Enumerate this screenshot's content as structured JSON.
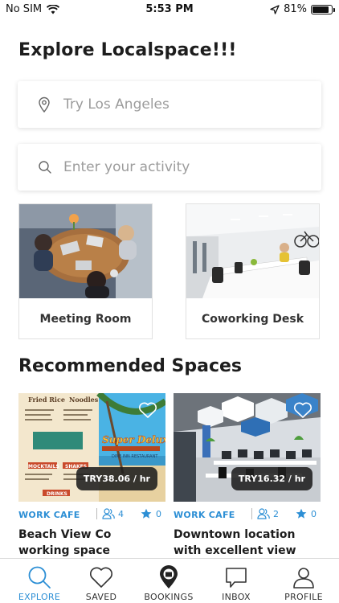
{
  "status_bar": {
    "carrier": "No SIM",
    "time": "5:53 PM",
    "battery": "81%",
    "battery_level": 0.81
  },
  "page_title": "Explore Localspace!!!",
  "search": {
    "location_placeholder": "Try Los Angeles",
    "activity_placeholder": "Enter your activity"
  },
  "categories": [
    {
      "label": "Meeting Room"
    },
    {
      "label": "Coworking Desk"
    }
  ],
  "section_title": "Recommended Spaces",
  "spaces": [
    {
      "type": "WORK CAFE",
      "capacity": "4",
      "rating": "0",
      "price": "TRY38.06 / hr",
      "title": "Beach View Co working space",
      "menu": {
        "left_head": "Fried Rice",
        "right_head": "Noodles",
        "sub1": "MOCKTAILS",
        "sub2": "SHAKES",
        "sub3": "DRINKS",
        "brand": "Super Deluxe",
        "tag": "DINE INN RESTAURANT"
      }
    },
    {
      "type": "WORK CAFE",
      "capacity": "2",
      "rating": "0",
      "price": "TRY16.32 / hr",
      "title": "Downtown location with excellent view"
    }
  ],
  "tabs": [
    {
      "label": "EXPLORE",
      "icon": "search-icon",
      "active": true
    },
    {
      "label": "SAVED",
      "icon": "heart-icon"
    },
    {
      "label": "BOOKINGS",
      "icon": "bookings-pin-icon"
    },
    {
      "label": "INBOX",
      "icon": "chat-bubble-icon"
    },
    {
      "label": "PROFILE",
      "icon": "profile-icon"
    }
  ],
  "colors": {
    "accent": "#2d8fd5",
    "text": "#1d1d1d",
    "placeholder": "#9c9c9c"
  }
}
